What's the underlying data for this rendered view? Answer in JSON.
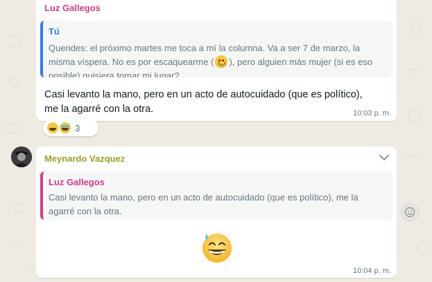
{
  "messages": [
    {
      "sender": "Luz Gallegos",
      "quote": {
        "author": "Tú",
        "text_before_emoji": "Querides: el próximo martes me toca a mí la columna. Va a ser 7 de marzo, la misma víspera. No es por escaquearme (",
        "text_after_emoji": "), pero alguien más mujer (si es eso posible) quisiera tomar mi lugar?"
      },
      "text": "Casi levanto la mano,  pero en un acto de autocuidado (que es político), me la agarré con la otra.",
      "time": "10:03 p. m.",
      "reactions": {
        "emojis": [
          "tears-of-joy-emoji",
          "star-struck-emoji"
        ],
        "count": "3"
      }
    },
    {
      "sender": "Meynardo Vazquez",
      "quote": {
        "author": "Luz Gallegos",
        "text": "Casi levanto la mano,  pero en un acto de autocuidado (que es político), me la agarré con la otra."
      },
      "emoji": "grinning-face-with-sweat-emoji",
      "time": "10:04 p. m."
    }
  ],
  "colors": {
    "background": "#efeae2",
    "bubble": "#ffffff",
    "sender1": "#d63a87",
    "sender2": "#97a125",
    "quote_self_bar": "#2f7cf6",
    "quote_other_bar": "#d63a87",
    "meta_text": "#667781"
  }
}
